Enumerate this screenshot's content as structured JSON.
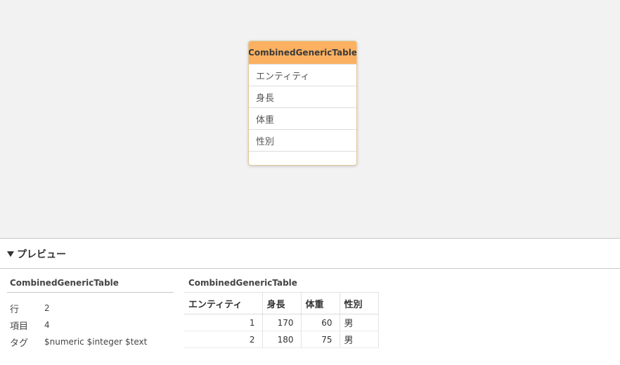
{
  "canvas": {
    "node": {
      "title": "CombinedGenericTable",
      "fields": [
        "エンティティ",
        "身長",
        "体重",
        "性別"
      ],
      "accent_color": "#fbb161"
    }
  },
  "preview": {
    "title": "プレビュー",
    "info": {
      "title": "CombinedGenericTable",
      "rows": [
        {
          "label": "行",
          "value": "2"
        },
        {
          "label": "項目",
          "value": "4"
        },
        {
          "label": "タグ",
          "value": "$numeric $integer $text"
        }
      ]
    },
    "table": {
      "title": "CombinedGenericTable",
      "columns": [
        "エンティティ",
        "身長",
        "体重",
        "性別"
      ],
      "rows": [
        [
          "1",
          "170",
          "60",
          "男"
        ],
        [
          "2",
          "180",
          "75",
          "男"
        ]
      ]
    }
  }
}
